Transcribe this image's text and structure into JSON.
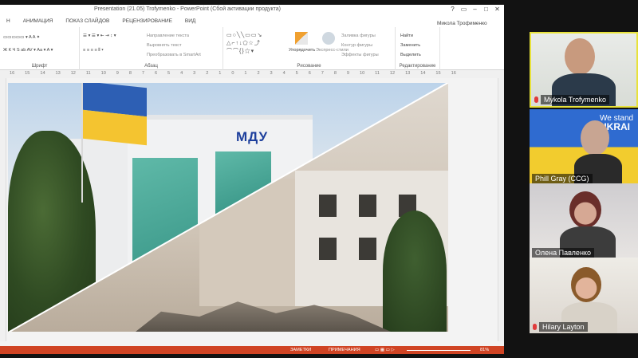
{
  "powerpoint": {
    "title": "Presentation (21.05) Trofymenko - PowerPoint (Сбой активации продукта)",
    "user": "Микола Трофименко",
    "window_buttons": [
      "?",
      "▭",
      "–",
      "□",
      "✕"
    ],
    "tabs": [
      "Н",
      "АНИМАЦИЯ",
      "ПОКАЗ СЛАЙДОВ",
      "РЕЦЕНЗИРОВАНИЕ",
      "ВИД"
    ],
    "ribbon": {
      "groups": [
        "Шрифт",
        "Абзац",
        "Рисование",
        "Редактирование"
      ],
      "paragraph_items": [
        "Направление текста",
        "Выровнять текст",
        "Преобразовать в SmartArt"
      ],
      "drawing_items": [
        "Упорядочить",
        "Экспресс-стили",
        "Заливка фигуры",
        "Контур фигуры",
        "Эффекты фигуры"
      ],
      "editing_items": [
        "Найти",
        "Заменить",
        "Выделить"
      ]
    },
    "ruler_ticks": [
      "16",
      "15",
      "14",
      "13",
      "12",
      "11",
      "10",
      "9",
      "8",
      "7",
      "6",
      "5",
      "4",
      "3",
      "2",
      "1",
      "0",
      "1",
      "2",
      "3",
      "4",
      "5",
      "6",
      "7",
      "8",
      "9",
      "10",
      "11",
      "12",
      "13",
      "14",
      "15",
      "16"
    ],
    "slide": {
      "sign_text": "МДУ"
    },
    "status": {
      "notes": "ЗАМЕТКИ",
      "comments": "ПРИМЕЧАНИЯ",
      "zoom": "81%"
    }
  },
  "participants": [
    {
      "name": "Mykola Trofymenko",
      "active_speaker": true,
      "muted": true
    },
    {
      "name": "Phill Gray (CCG)",
      "muted": false,
      "background_text": [
        "We stand",
        "UKRAI"
      ]
    },
    {
      "name": "Олена Павленко",
      "muted": false
    },
    {
      "name": "Hilary Layton",
      "muted": true
    }
  ],
  "colors": {
    "ppt_accent": "#d04424",
    "active_speaker_border": "#e8e23b",
    "flag_blue": "#2d5fb4",
    "flag_yellow": "#f4c430"
  }
}
